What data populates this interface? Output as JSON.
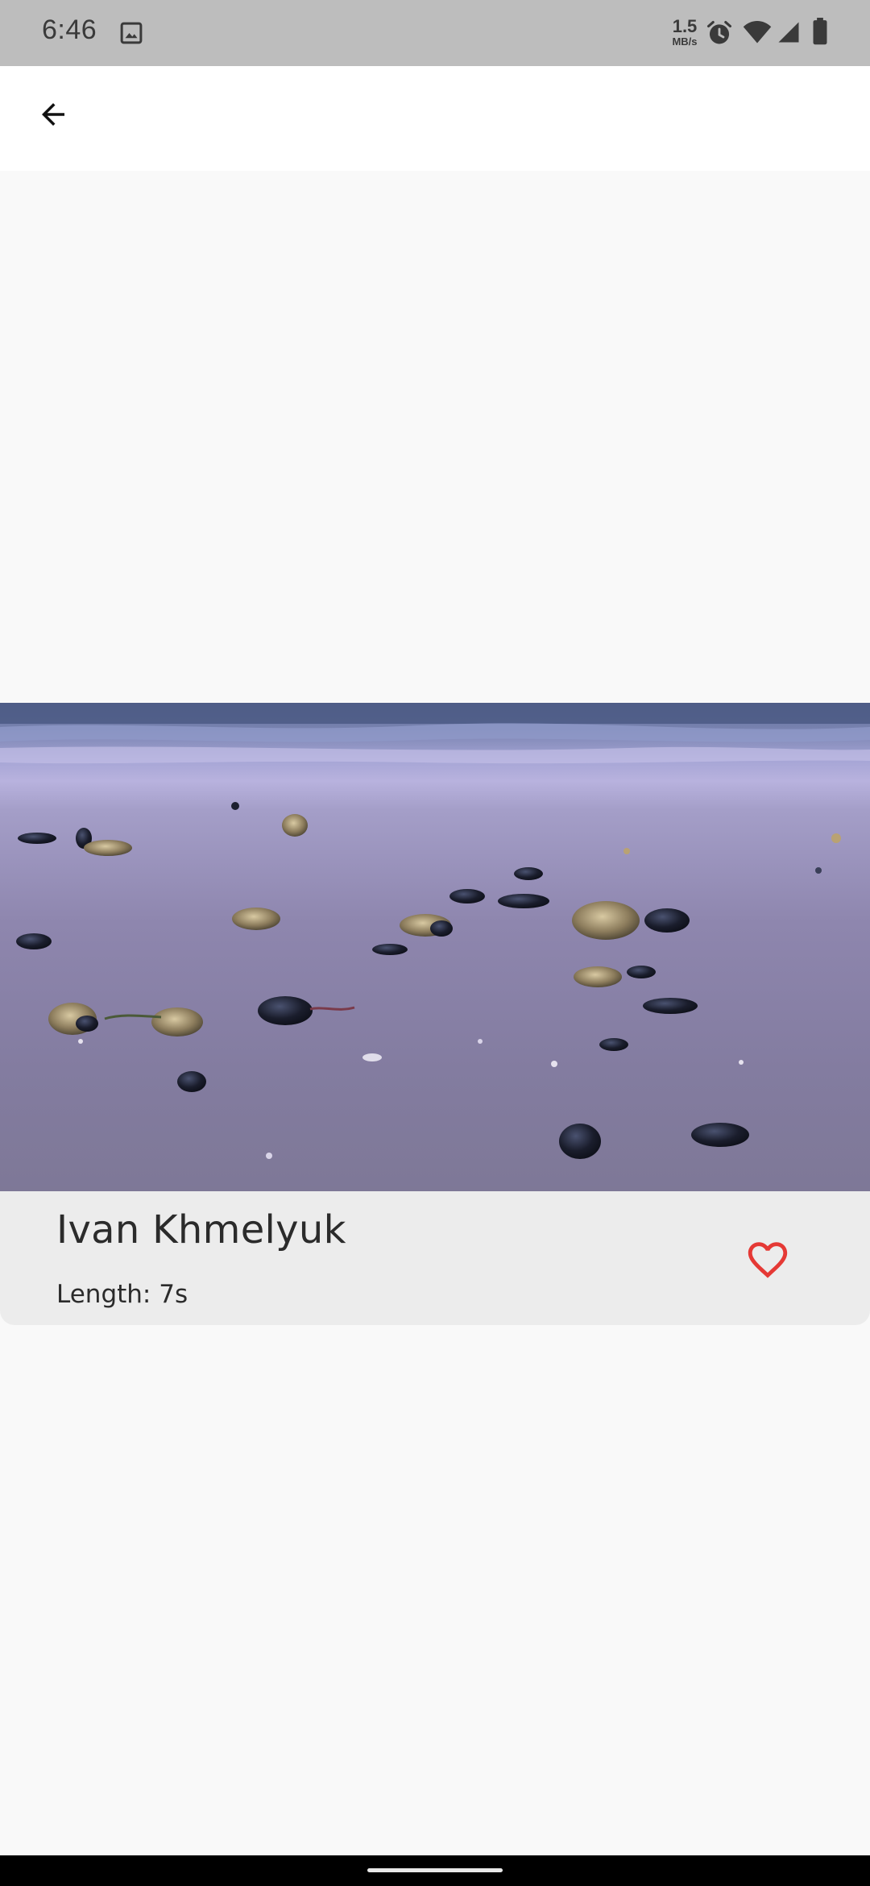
{
  "status_bar": {
    "time": "6:46",
    "speed_value": "1.5",
    "speed_unit": "MB/s",
    "icons": [
      "gallery-icon",
      "alarm-icon",
      "wifi-icon",
      "signal-icon",
      "battery-icon"
    ]
  },
  "app_bar": {
    "back_icon": "arrow-back-icon"
  },
  "photo": {
    "subject": "beach-mussel-shells-image"
  },
  "card": {
    "author": "Ivan Khmelyuk",
    "length": "Length: 7s",
    "favorite_icon": "heart-outline-icon",
    "favorite_color": "#e53935"
  },
  "colors": {
    "status_bar_bg": "#bdbdbd",
    "app_bar_bg": "#ffffff",
    "page_bg": "#f9f9f9",
    "card_bg": "#ececec",
    "nav_bar_bg": "#000000"
  }
}
